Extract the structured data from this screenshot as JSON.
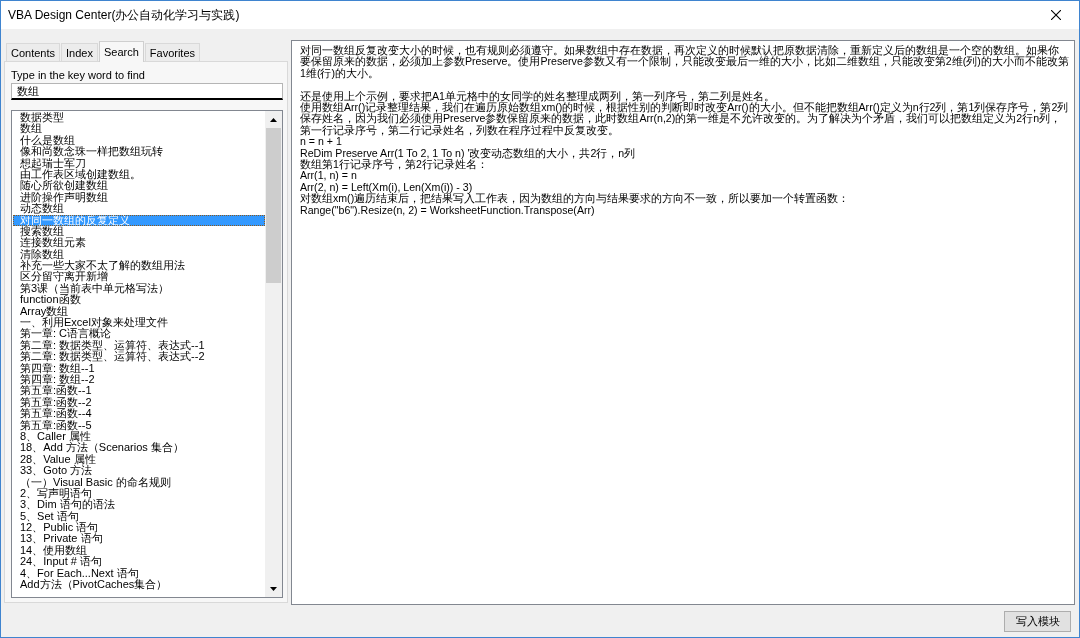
{
  "window": {
    "title": "VBA Design Center(办公自动化学习与实践)"
  },
  "tabs": [
    {
      "label": "Contents",
      "selected": false
    },
    {
      "label": "Index",
      "selected": false
    },
    {
      "label": "Search",
      "selected": true
    },
    {
      "label": "Favorites",
      "selected": false
    }
  ],
  "search": {
    "label": "Type in the key word to find",
    "value": "数组"
  },
  "topics": [
    {
      "label": "数据类型",
      "selected": false
    },
    {
      "label": "数组",
      "selected": false
    },
    {
      "label": "什么是数组",
      "selected": false
    },
    {
      "label": "像和尚数念珠一样把数组玩转",
      "selected": false
    },
    {
      "label": "想起瑞士军刀",
      "selected": false
    },
    {
      "label": "由工作表区域创建数组。",
      "selected": false
    },
    {
      "label": "随心所欲创建数组",
      "selected": false
    },
    {
      "label": "进阶操作声明数组",
      "selected": false
    },
    {
      "label": "动态数组",
      "selected": false
    },
    {
      "label": "对同一数组的反复定义",
      "selected": true
    },
    {
      "label": "搜索数组",
      "selected": false
    },
    {
      "label": "连接数组元素",
      "selected": false
    },
    {
      "label": "清除数组",
      "selected": false
    },
    {
      "label": "补充一些大家不太了解的数组用法",
      "selected": false
    },
    {
      "label": "区分留守离开新增",
      "selected": false
    },
    {
      "label": "第3课（当前表中单元格写法）",
      "selected": false
    },
    {
      "label": "function函数",
      "selected": false
    },
    {
      "label": "Array数组",
      "selected": false
    },
    {
      "label": "一、利用Excel对象来处理文件",
      "selected": false
    },
    {
      "label": "第一章: C语言概论",
      "selected": false
    },
    {
      "label": "第二章: 数据类型、运算符、表达式--1",
      "selected": false
    },
    {
      "label": "第二章: 数据类型、运算符、表达式--2",
      "selected": false
    },
    {
      "label": "第四章: 数组--1",
      "selected": false
    },
    {
      "label": "第四章: 数组--2",
      "selected": false
    },
    {
      "label": "第五章:函数--1",
      "selected": false
    },
    {
      "label": "第五章:函数--2",
      "selected": false
    },
    {
      "label": "第五章:函数--4",
      "selected": false
    },
    {
      "label": "第五章:函数--5",
      "selected": false
    },
    {
      "label": "8、Caller 属性",
      "selected": false
    },
    {
      "label": "18、Add 方法（Scenarios 集合）",
      "selected": false
    },
    {
      "label": "28、Value 属性",
      "selected": false
    },
    {
      "label": "33、Goto 方法",
      "selected": false
    },
    {
      "label": "（一）Visual Basic 的命名规则",
      "selected": false
    },
    {
      "label": "2、写声明语句",
      "selected": false
    },
    {
      "label": "3、Dim 语句的语法",
      "selected": false
    },
    {
      "label": "5、Set 语句",
      "selected": false
    },
    {
      "label": "12、Public 语句",
      "selected": false
    },
    {
      "label": "13、Private 语句",
      "selected": false
    },
    {
      "label": "14、使用数组",
      "selected": false
    },
    {
      "label": "24、Input # 语句",
      "selected": false
    },
    {
      "label": "4、For Each...Next 语句",
      "selected": false
    },
    {
      "label": "Add方法（PivotCaches集合）",
      "selected": false
    }
  ],
  "content": {
    "sections": [
      [
        "对同一数组反复改变大小的时候，也有规则必须遵守。如果数组中存在数据，再次定义的时候默认把原数据清除，重新定义后的数组是一个空的数组。如果你要保留原来的数据，必须加上参数Preserve。使用Preserve参数又有一个限制，只能改变最后一维的大小，比如二维数组，只能改变第2维(列)的大小而不能改第1维(行)的大小。"
      ],
      [
        "还是使用上个示例，要求把A1单元格中的女同学的姓名整理成两列，第一列序号，第二列是姓名。",
        "使用数组Arr()记录整理结果，我们在遍历原始数组xm()的时候，根据性别的判断即时改变Arr()的大小。但不能把数组Arr()定义为n行2列，第1列保存序号，第2列保存姓名，因为我们必须使用Preserve参数保留原来的数据，此时数组Arr(n,2)的第一维是不允许改变的。为了解决为个矛盾，我们可以把数组定义为2行n列，第一行记录序号，第二行记录姓名，列数在程序过程中反复改变。",
        "n = n + 1",
        "ReDim Preserve Arr(1 To 2, 1 To n) '改变动态数组的大小，共2行，n列",
        "数组第1行记录序号，第2行记录姓名：",
        "Arr(1, n) = n",
        "Arr(2, n) = Left(Xm(i), Len(Xm(i)) - 3)",
        "对数组xm()遍历结束后，把结果写入工作表，因为数组的方向与结果要求的方向不一致，所以要加一个转置函数：",
        "Range(\"b6\").Resize(n, 2) = WorksheetFunction.Transpose(Arr)"
      ]
    ]
  },
  "footer": {
    "button": "写入模块"
  }
}
